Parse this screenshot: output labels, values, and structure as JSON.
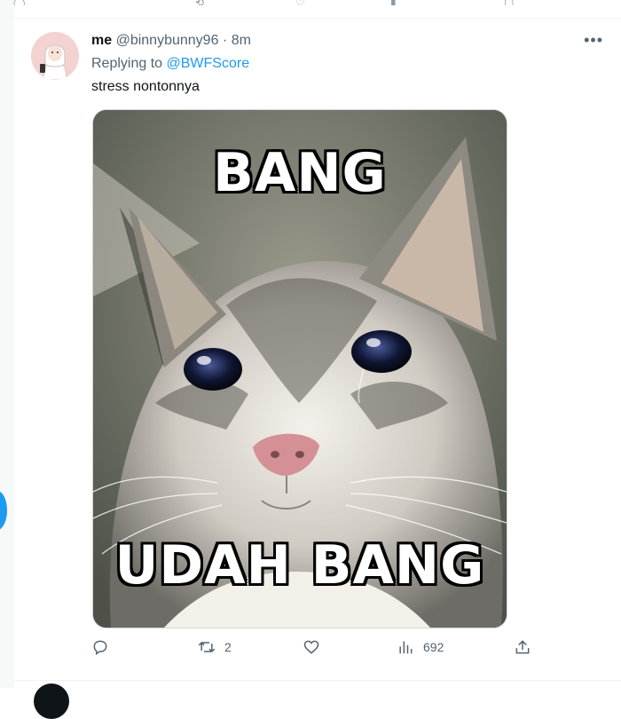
{
  "tweet": {
    "name": "me",
    "handle": "@binnybunny96",
    "separator": "·",
    "time": "8m",
    "replying_prefix": "Replying to ",
    "replying_to": "@BWFScore",
    "text": "stress nontonnya",
    "more_icon": "more-icon",
    "image": {
      "top_text": "BANG",
      "bottom_text": "UDAH BANG"
    },
    "actions": {
      "reply_count": "",
      "retweet_count": "2",
      "like_count": "",
      "views_count": "692"
    }
  },
  "colors": {
    "accent": "#1d9bf0",
    "muted": "#536471",
    "text": "#0f1419"
  }
}
